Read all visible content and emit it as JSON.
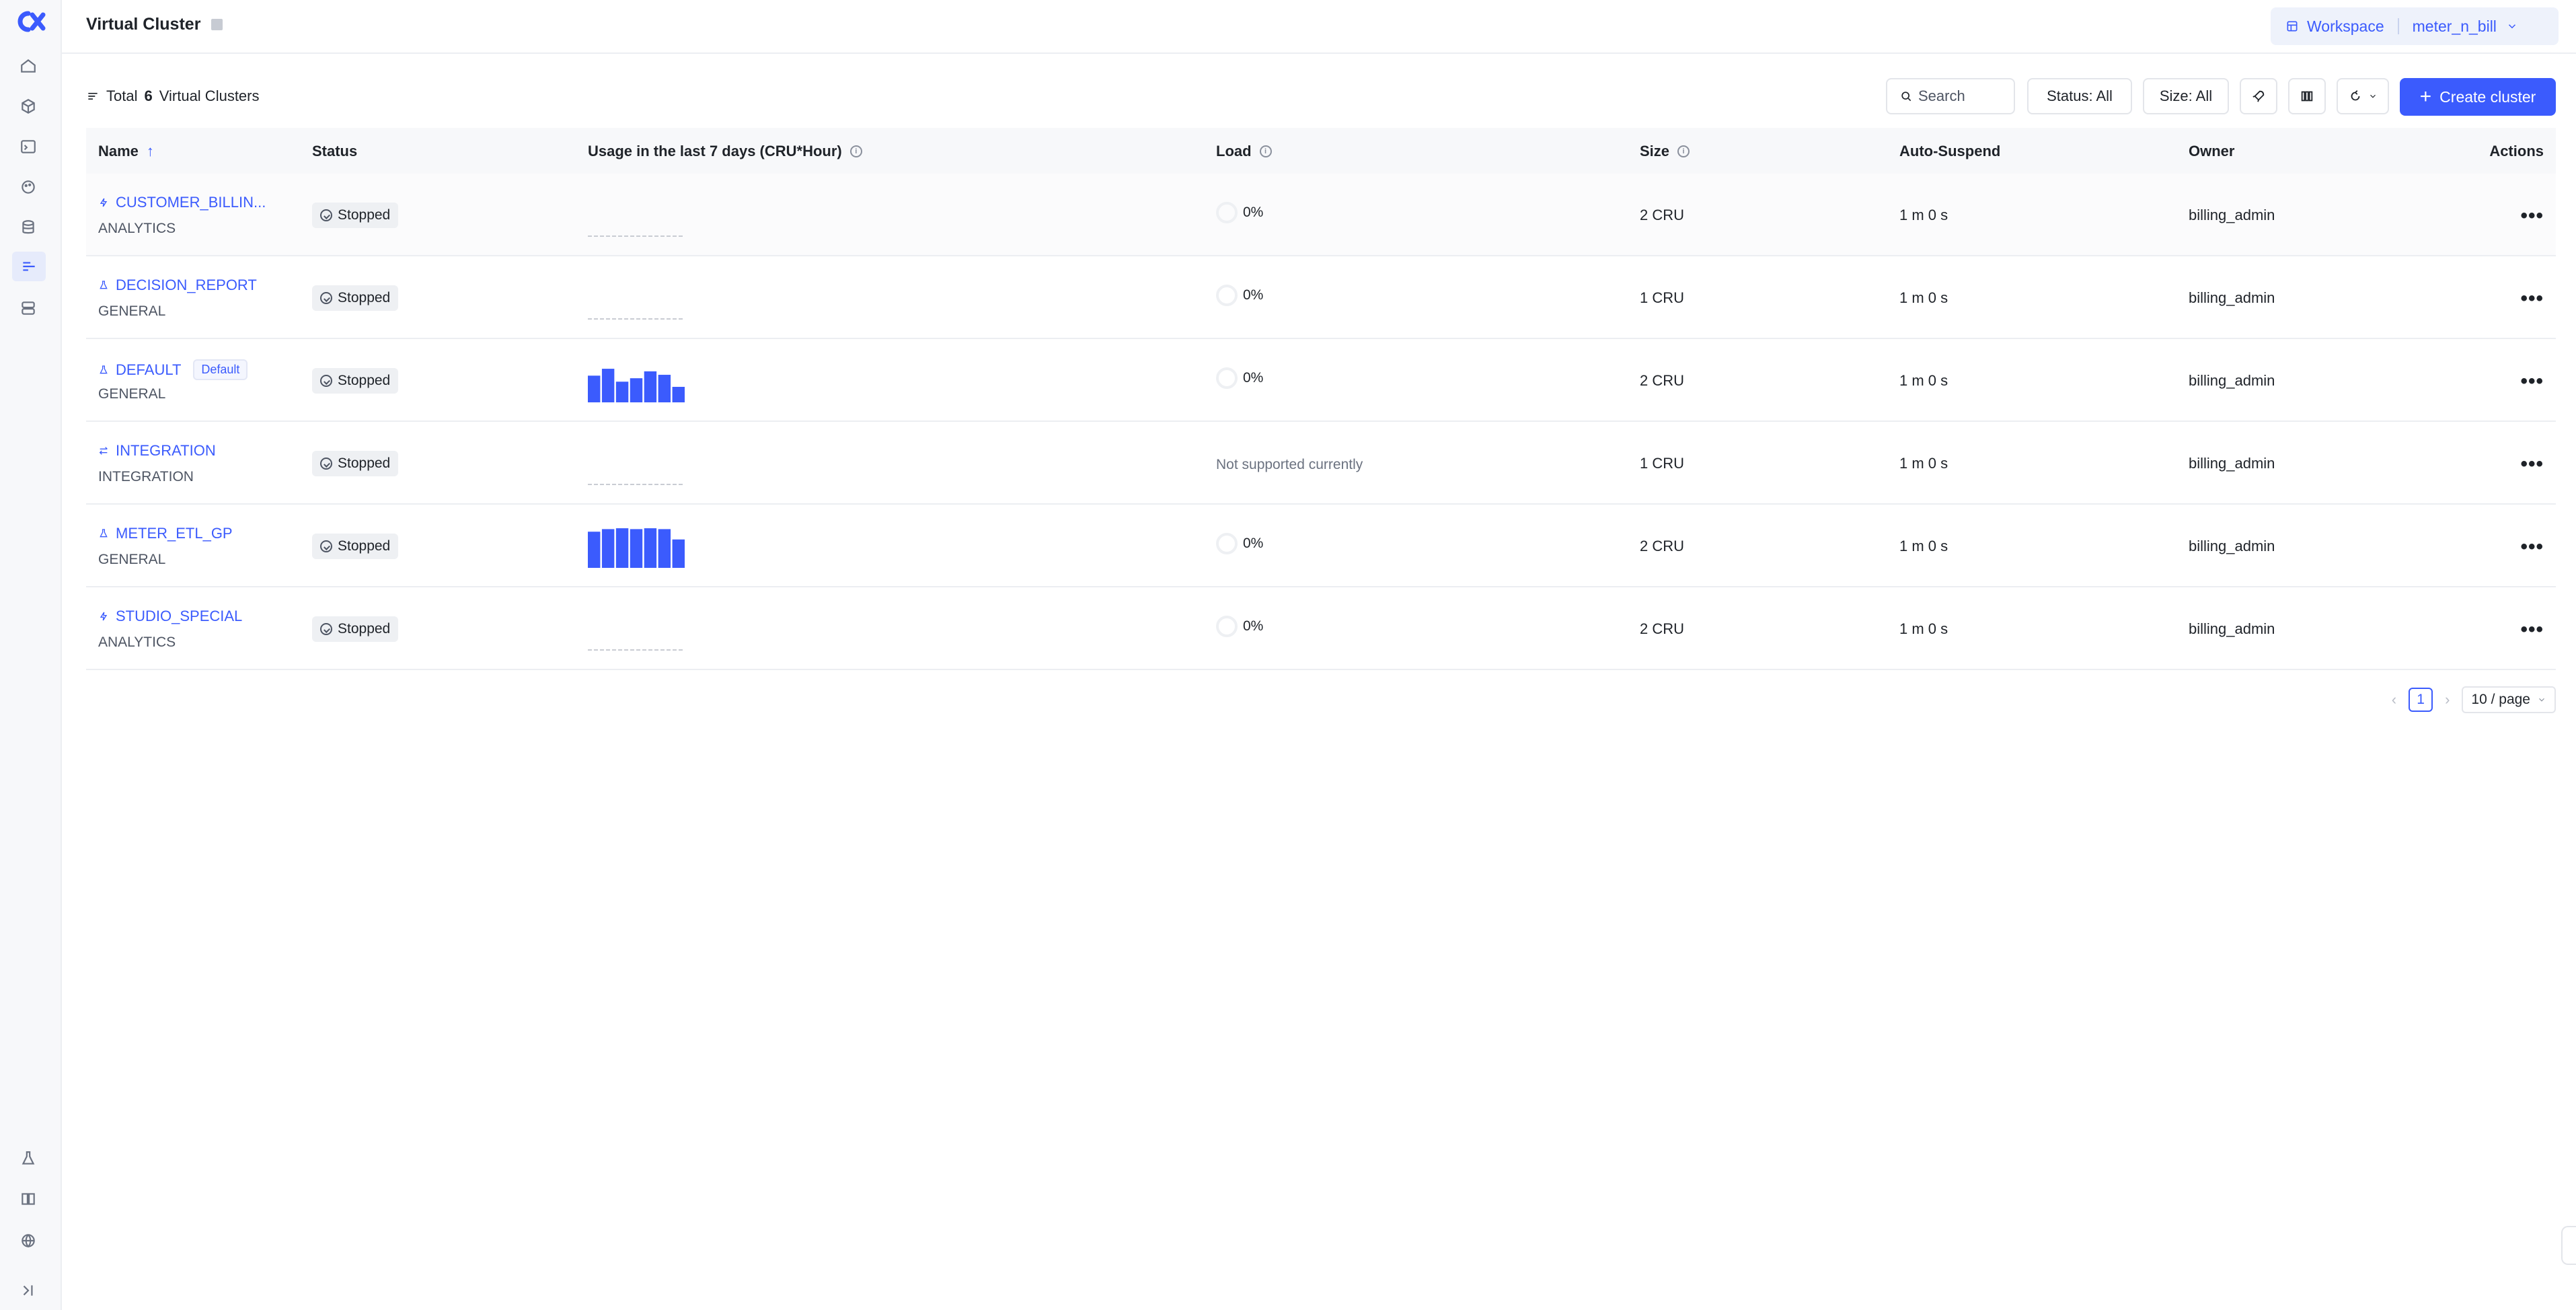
{
  "header": {
    "title": "Virtual Cluster",
    "workspace_label": "Workspace",
    "workspace_name": "meter_n_bill"
  },
  "toolbar": {
    "total_prefix": "Total",
    "total_count": "6",
    "total_suffix": "Virtual Clusters",
    "search_placeholder": "Search",
    "status_filter": "Status: All",
    "size_filter": "Size: All",
    "create_label": "Create cluster"
  },
  "table": {
    "columns": {
      "name": "Name",
      "status": "Status",
      "usage": "Usage in the last 7 days (CRU*Hour)",
      "load": "Load",
      "size": "Size",
      "auto_suspend": "Auto-Suspend",
      "owner": "Owner",
      "actions": "Actions"
    },
    "rows": [
      {
        "name": "CUSTOMER_BILLIN...",
        "type": "ANALYTICS",
        "icon": "bolt-icon",
        "status": "Stopped",
        "usage": [],
        "load": "0%",
        "size": "2 CRU",
        "auto_suspend": "1 m 0 s",
        "owner": "billing_admin"
      },
      {
        "name": "DECISION_REPORT",
        "type": "GENERAL",
        "icon": "flask-icon",
        "status": "Stopped",
        "usage": [],
        "load": "0%",
        "size": "1 CRU",
        "auto_suspend": "1 m 0 s",
        "owner": "billing_admin"
      },
      {
        "name": "DEFAULT",
        "tag": "Default",
        "type": "GENERAL",
        "icon": "flask-icon",
        "status": "Stopped",
        "usage": [
          0.62,
          0.78,
          0.48,
          0.56,
          0.72,
          0.64,
          0.36
        ],
        "load": "0%",
        "size": "2 CRU",
        "auto_suspend": "1 m 0 s",
        "owner": "billing_admin"
      },
      {
        "name": "INTEGRATION",
        "type": "INTEGRATION",
        "icon": "swap-icon",
        "status": "Stopped",
        "usage": [],
        "load_note": "Not supported currently",
        "size": "1 CRU",
        "auto_suspend": "1 m 0 s",
        "owner": "billing_admin"
      },
      {
        "name": "METER_ETL_GP",
        "type": "GENERAL",
        "icon": "flask-icon",
        "status": "Stopped",
        "usage": [
          0.84,
          0.9,
          0.92,
          0.9,
          0.92,
          0.9,
          0.66
        ],
        "load": "0%",
        "size": "2 CRU",
        "auto_suspend": "1 m 0 s",
        "owner": "billing_admin"
      },
      {
        "name": "STUDIO_SPECIAL",
        "type": "ANALYTICS",
        "icon": "bolt-icon",
        "status": "Stopped",
        "usage": [],
        "load": "0%",
        "size": "2 CRU",
        "auto_suspend": "1 m 0 s",
        "owner": "billing_admin"
      }
    ]
  },
  "pagination": {
    "current_page": "1",
    "page_size": "10 / page"
  },
  "colors": {
    "accent": "#3b5bfd"
  }
}
